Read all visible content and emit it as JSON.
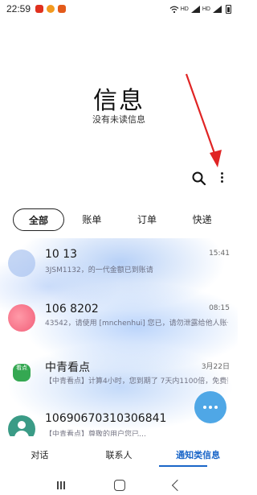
{
  "status_bar": {
    "time": "22:59",
    "hd_label": "HD",
    "battery_label": "HD"
  },
  "header": {
    "title": "信息",
    "subtitle": "没有未读信息"
  },
  "actions": {
    "search_icon": "search-icon",
    "more_icon": "more-vertical-icon"
  },
  "tabs": [
    {
      "label": "全部",
      "active": true
    },
    {
      "label": "账单",
      "active": false
    },
    {
      "label": "订单",
      "active": false
    },
    {
      "label": "快递",
      "active": false
    }
  ],
  "conversations": [
    {
      "title": "10         13",
      "time": "15:41",
      "preview": "            3JSM1132，的一代金额已到账请"
    },
    {
      "title": "106     8202",
      "time": "08:15",
      "preview": "          43542，请使用 [mnchenhui] 您已，请勿泄露给他人账号安全。"
    },
    {
      "title": "中青看点",
      "time": "3月22日",
      "preview": "【中青看点】计算4小时，您到期了  7天内1100倍，免费获了，的可提现…"
    },
    {
      "title": "1069067031030684​1",
      "time": "",
      "preview": "【中青看点】尊敬的用户您已…"
    }
  ],
  "avatar_badge_text": "看点",
  "bottom_tabs": [
    {
      "label": "对话",
      "active": false
    },
    {
      "label": "联系人",
      "active": false
    },
    {
      "label": "通知类信息",
      "active": true
    }
  ],
  "colors": {
    "accent": "#1a66c8",
    "annotation_arrow": "#e02424",
    "fab": "#4fa7e6"
  }
}
